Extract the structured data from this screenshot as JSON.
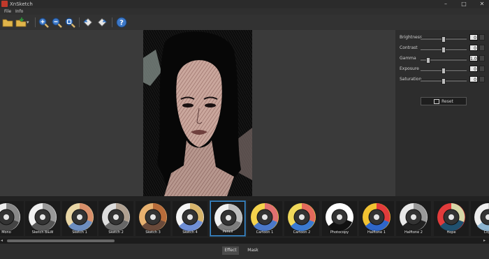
{
  "window": {
    "title": "XnSketch"
  },
  "menu": {
    "items": [
      "File",
      "Info"
    ]
  },
  "toolbar": {
    "icons": [
      "open-folder-icon",
      "save-icon",
      "zoom-in-icon",
      "zoom-out-icon",
      "zoom-fit-icon",
      "rotate-left-icon",
      "rotate-right-icon",
      "help-icon"
    ]
  },
  "adjustments": [
    {
      "label": "Brightness",
      "value": "0",
      "level": 0.5
    },
    {
      "label": "Contrast",
      "value": "0",
      "level": 0.5
    },
    {
      "label": "Gamma",
      "value": "1.00",
      "level": 0.15
    },
    {
      "label": "Exposure",
      "value": "0",
      "level": 0.5
    },
    {
      "label": "Saturation",
      "value": "0",
      "level": 0.5
    }
  ],
  "reset_label": "Reset",
  "effects": [
    {
      "label": "Mono",
      "colors": [
        "#eee",
        "#888",
        "#444"
      ]
    },
    {
      "label": "Sketch B&W",
      "colors": [
        "#f0f0f0",
        "#999",
        "#555"
      ]
    },
    {
      "label": "Sketch 1",
      "colors": [
        "#e9d6a6",
        "#d88f6a",
        "#6c8dbf"
      ]
    },
    {
      "label": "Sketch 2",
      "colors": [
        "#ddd",
        "#b0a090",
        "#666"
      ]
    },
    {
      "label": "Sketch 3",
      "colors": [
        "#e7b170",
        "#b86c3a",
        "#6a4a3a"
      ]
    },
    {
      "label": "Sketch 4",
      "colors": [
        "#f5f5f5",
        "#d7b46b",
        "#6f8fd6"
      ]
    },
    {
      "label": "Pencil",
      "colors": [
        "#f2f2f2",
        "#bdbdbd",
        "#7c7c7c"
      ]
    },
    {
      "label": "Cartoon 1",
      "colors": [
        "#f4d34c",
        "#e07070",
        "#4b78c8"
      ]
    },
    {
      "label": "Cartoon 2",
      "colors": [
        "#f0d85a",
        "#e36a5c",
        "#3b7ad0"
      ]
    },
    {
      "label": "Photocopy",
      "colors": [
        "#ffffff",
        "#ffffff",
        "#111111"
      ]
    },
    {
      "label": "Halftone 1",
      "colors": [
        "#f1c232",
        "#e23b3b",
        "#2f66c8"
      ]
    },
    {
      "label": "Halftone 2",
      "colors": [
        "#e8e8e8",
        "#999",
        "#222"
      ]
    },
    {
      "label": "Hope",
      "colors": [
        "#e23b3b",
        "#d7d7a8",
        "#20506e"
      ]
    },
    {
      "label": "Copy",
      "colors": [
        "#eee",
        "#ccc",
        "#8cb4d0"
      ]
    }
  ],
  "tabs": [
    "Effect",
    "Mask"
  ],
  "colors": {
    "accent": "#3c8fd4"
  }
}
